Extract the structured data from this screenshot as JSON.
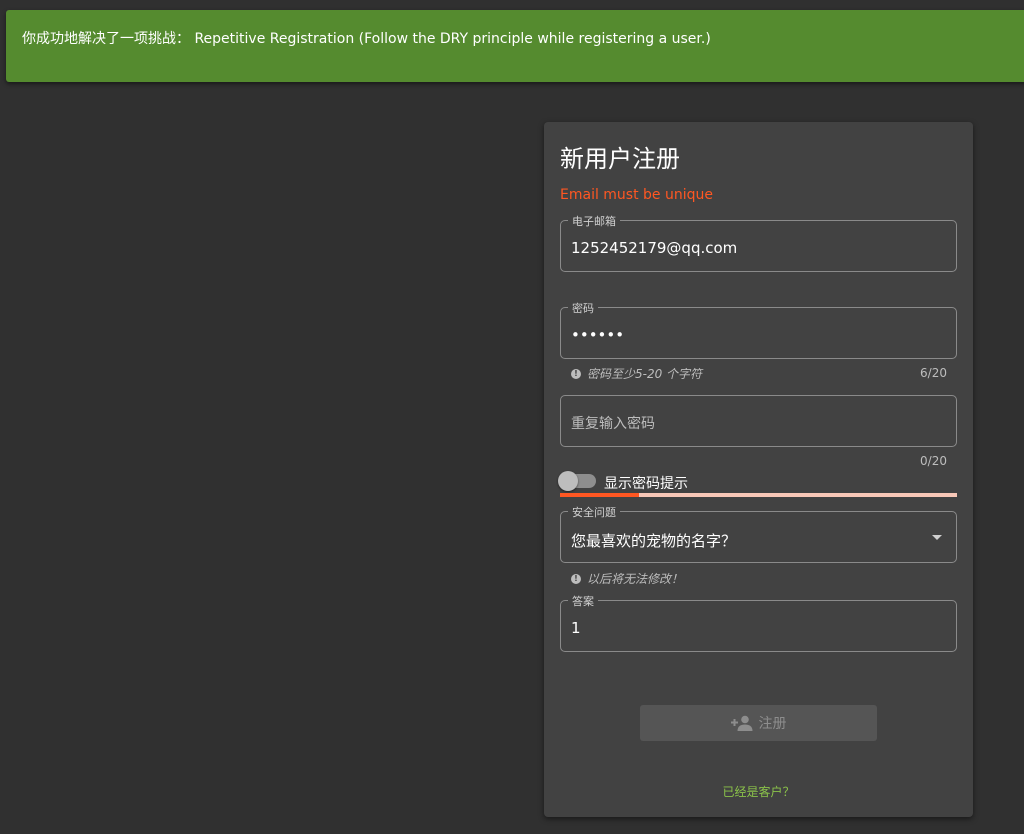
{
  "banner": {
    "prefix": "你成功地解决了一项挑战：",
    "challenge": " Repetitive Registration (Follow the DRY principle while registering a user.)"
  },
  "form": {
    "title": "新用户注册",
    "error": "Email must be unique",
    "email": {
      "label": "电子邮箱",
      "value": "1252452179@qq.com"
    },
    "password": {
      "label": "密码",
      "value": "••••••",
      "hint": "密码至少5-20 个字符",
      "counter": "6/20"
    },
    "repeat_password": {
      "placeholder": "重复输入密码",
      "counter": "0/20"
    },
    "show_hint_toggle": {
      "label": "显示密码提示",
      "checked": false
    },
    "strength": {
      "level_percent": 20,
      "colors": {
        "fill": "#ff5722",
        "track": "#f8c8b8"
      }
    },
    "security_question": {
      "label": "安全问题",
      "value": "您最喜欢的宠物的名字？",
      "hint": "以后将无法修改！"
    },
    "answer": {
      "label": "答案",
      "value": "1"
    },
    "submit": {
      "label": "注册",
      "icon": "person-add-icon"
    },
    "login_link": "已经是客户？"
  },
  "colors": {
    "banner": "#558b2f",
    "error": "#ff5722",
    "link": "#8bc34a",
    "card": "#424242",
    "background": "#303030"
  }
}
